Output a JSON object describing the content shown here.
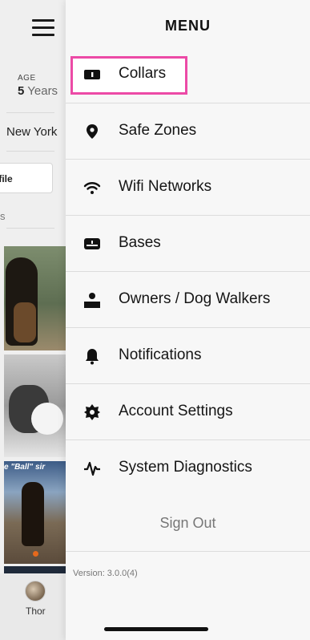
{
  "background": {
    "age_label": "AGE",
    "age_value": "5",
    "age_unit": "Years",
    "city": "New York",
    "profile_button": "ofile",
    "section_letter": "s",
    "photo_caption": "e \"Ball\" sir",
    "tab": {
      "name": "Thor"
    }
  },
  "menu": {
    "title": "MENU",
    "items": [
      {
        "label": "Collars",
        "icon": "collar-icon"
      },
      {
        "label": "Safe Zones",
        "icon": "location-pin-icon"
      },
      {
        "label": "Wifi Networks",
        "icon": "wifi-icon"
      },
      {
        "label": "Bases",
        "icon": "base-station-icon"
      },
      {
        "label": "Owners / Dog Walkers",
        "icon": "person-icon"
      },
      {
        "label": "Notifications",
        "icon": "bell-icon"
      },
      {
        "label": "Account Settings",
        "icon": "gear-icon"
      },
      {
        "label": "System Diagnostics",
        "icon": "pulse-icon"
      }
    ],
    "sign_out": "Sign Out",
    "version": "Version: 3.0.0(4)",
    "highlight_color": "#ec4aa6"
  }
}
